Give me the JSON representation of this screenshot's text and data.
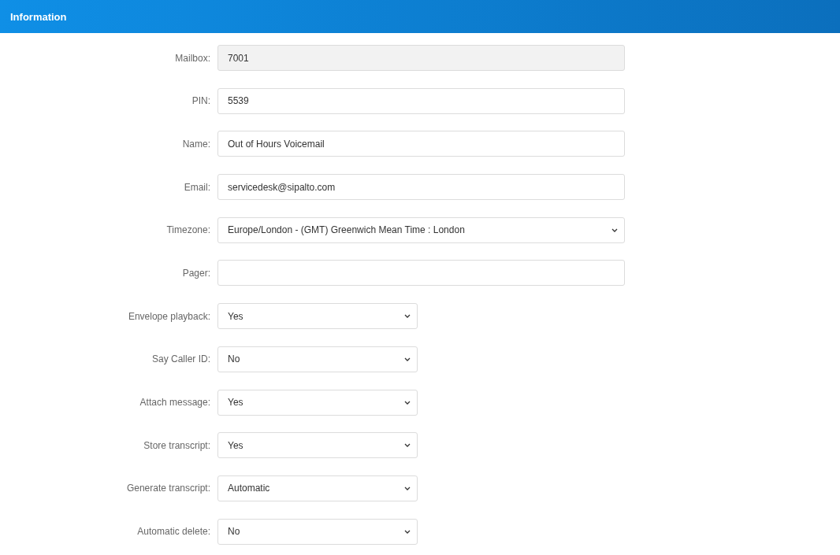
{
  "header": {
    "title": "Information"
  },
  "fields": [
    {
      "label": "Mailbox:",
      "kind": "text",
      "value": "7001",
      "disabled": true,
      "wide": true
    },
    {
      "label": "PIN:",
      "kind": "text",
      "value": "5539",
      "disabled": false,
      "wide": true
    },
    {
      "label": "Name:",
      "kind": "text",
      "value": "Out of Hours Voicemail",
      "disabled": false,
      "wide": true
    },
    {
      "label": "Email:",
      "kind": "text",
      "value": "servicedesk@sipalto.com",
      "disabled": false,
      "wide": true
    },
    {
      "label": "Timezone:",
      "kind": "select",
      "value": "Europe/London - (GMT) Greenwich Mean Time : London",
      "disabled": false,
      "wide": true
    },
    {
      "label": "Pager:",
      "kind": "text",
      "disabled": false,
      "wide": true
    },
    {
      "label": "Envelope playback:",
      "kind": "select",
      "value": "Yes",
      "disabled": false,
      "wide": false
    },
    {
      "label": "Say Caller ID:",
      "kind": "select",
      "value": "No",
      "disabled": false,
      "wide": false
    },
    {
      "label": "Attach message:",
      "kind": "select",
      "value": "Yes",
      "disabled": false,
      "wide": false
    },
    {
      "label": "Store transcript:",
      "kind": "select",
      "value": "Yes",
      "disabled": false,
      "wide": false
    },
    {
      "label": "Generate transcript:",
      "kind": "select",
      "value": "Automatic",
      "disabled": false,
      "wide": false
    },
    {
      "label": "Automatic delete:",
      "kind": "select",
      "value": "No",
      "disabled": false,
      "wide": false
    }
  ]
}
